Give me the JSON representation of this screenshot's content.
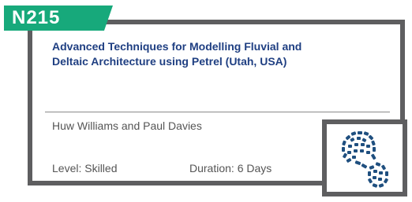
{
  "course": {
    "code": "N215",
    "title_line1": "Advanced Techniques for Modelling Fluvial and",
    "title_line2": "Deltaic Architecture using Petrel (Utah, USA)",
    "authors": "Huw Williams and Paul Davies",
    "level": "Level: Skilled",
    "duration": "Duration: 6 Days"
  },
  "icon": {
    "name": "boot-print-icon",
    "color": "#1f4f7f"
  },
  "colors": {
    "badge": "#17a97b",
    "title": "#1f3f82",
    "border": "#5e5e60",
    "text": "#555555"
  }
}
